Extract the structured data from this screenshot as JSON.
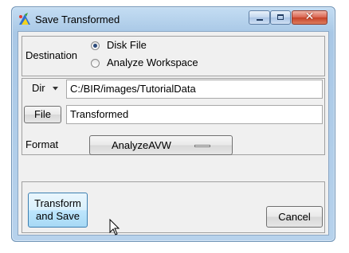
{
  "window": {
    "title": "Save Transformed",
    "close_glyph": "✕"
  },
  "destination": {
    "label": "Destination",
    "options": [
      {
        "label": "Disk File",
        "selected": true
      },
      {
        "label": "Analyze Workspace",
        "selected": false
      }
    ]
  },
  "dir": {
    "label": "Dir",
    "value": "C:/BIR/images/TutorialData"
  },
  "file": {
    "button_label": "File",
    "value": "Transformed"
  },
  "format": {
    "label": "Format",
    "selected": "AnalyzeAVW"
  },
  "buttons": {
    "transform_line1": "Transform",
    "transform_line2": "and Save",
    "cancel": "Cancel"
  },
  "icons": [
    "app-icon",
    "minimize-icon",
    "maximize-icon",
    "close-icon",
    "dropdown-arrow-icon",
    "mouse-pointer-icon"
  ],
  "colors": {
    "titlebar": "#b7d2ec",
    "close_button": "#c64228",
    "hot_button": "#bee6fd",
    "client_bg": "#f0f0f0"
  }
}
